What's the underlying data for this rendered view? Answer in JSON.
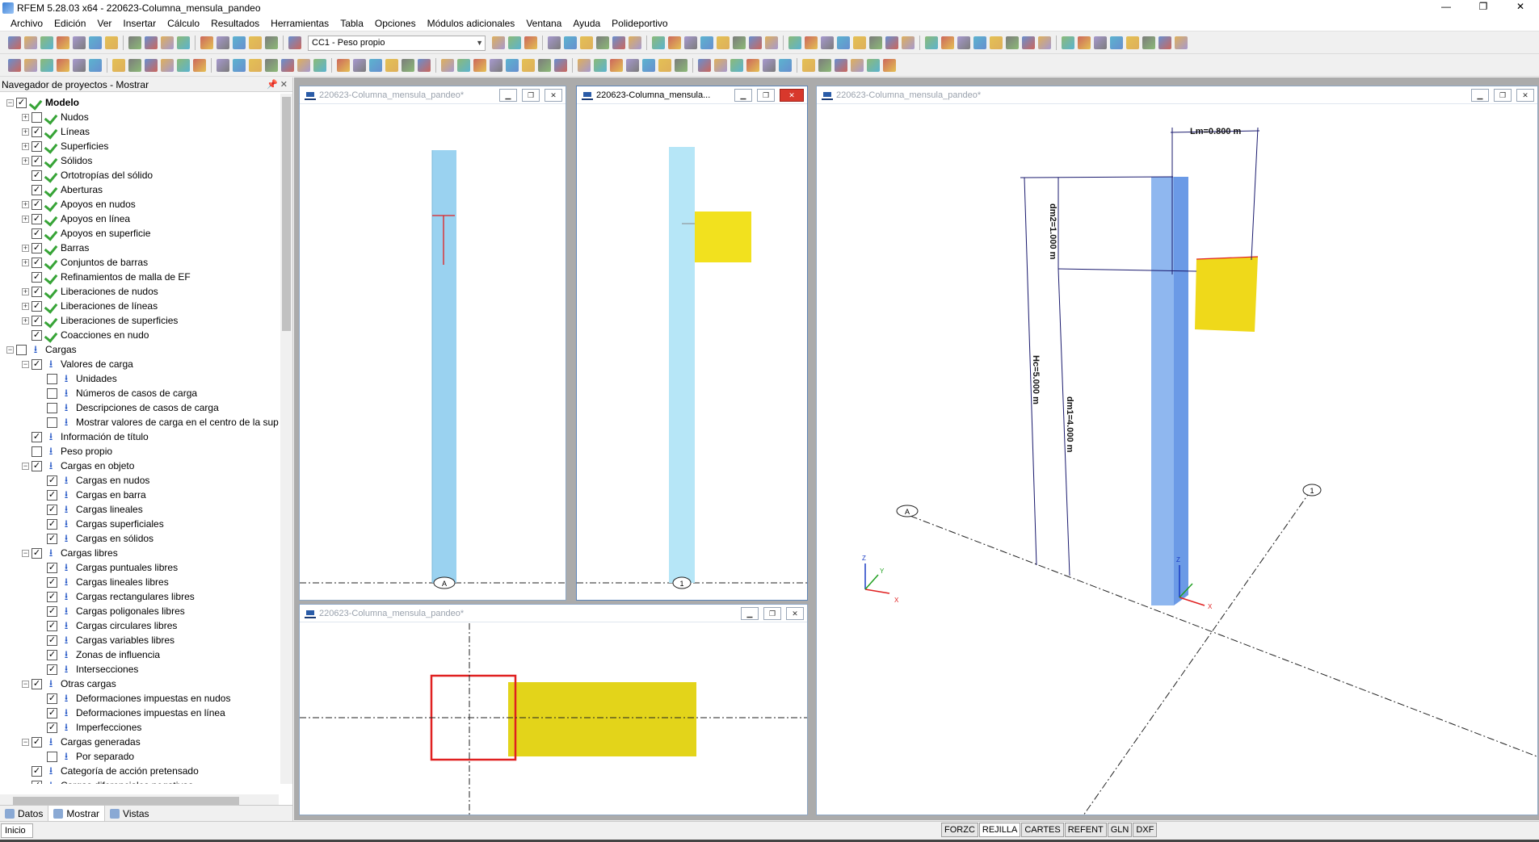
{
  "app": {
    "title": "RFEM 5.28.03 x64 - 220623-Columna_mensula_pandeo",
    "window_buttons": [
      "—",
      "❐",
      "✕"
    ]
  },
  "menu": [
    "Archivo",
    "Edición",
    "Ver",
    "Insertar",
    "Cálculo",
    "Resultados",
    "Herramientas",
    "Tabla",
    "Opciones",
    "Módulos adicionales",
    "Ventana",
    "Ayuda",
    "Polideportivo"
  ],
  "toolbar": {
    "load_case_combo": "CC1 - Peso propio"
  },
  "navigator": {
    "title": "Navegador de proyectos - Mostrar",
    "pin_icons": "📌 ✕",
    "tabs": [
      {
        "label": "Datos",
        "icon": "data-icon"
      },
      {
        "label": "Mostrar",
        "icon": "display-icon"
      },
      {
        "label": "Vistas",
        "icon": "views-icon"
      }
    ],
    "tree": [
      {
        "level": 0,
        "exp": "−",
        "checked": true,
        "icon": "model",
        "label": "Modelo",
        "bold": true
      },
      {
        "level": 1,
        "exp": "+",
        "checked": false,
        "icon": "model",
        "label": "Nudos"
      },
      {
        "level": 1,
        "exp": "+",
        "checked": true,
        "icon": "model",
        "label": "Líneas"
      },
      {
        "level": 1,
        "exp": "+",
        "checked": true,
        "icon": "model",
        "label": "Superficies"
      },
      {
        "level": 1,
        "exp": "+",
        "checked": true,
        "icon": "model",
        "label": "Sólidos"
      },
      {
        "level": 1,
        "exp": "",
        "checked": true,
        "icon": "model",
        "label": "Ortotropías del sólido"
      },
      {
        "level": 1,
        "exp": "",
        "checked": true,
        "icon": "model",
        "label": "Aberturas"
      },
      {
        "level": 1,
        "exp": "+",
        "checked": true,
        "icon": "model",
        "label": "Apoyos en nudos"
      },
      {
        "level": 1,
        "exp": "+",
        "checked": true,
        "icon": "model",
        "label": "Apoyos en línea"
      },
      {
        "level": 1,
        "exp": "",
        "checked": true,
        "icon": "model",
        "label": "Apoyos en superficie"
      },
      {
        "level": 1,
        "exp": "+",
        "checked": true,
        "icon": "model",
        "label": "Barras"
      },
      {
        "level": 1,
        "exp": "+",
        "checked": true,
        "icon": "model",
        "label": "Conjuntos de barras"
      },
      {
        "level": 1,
        "exp": "",
        "checked": true,
        "icon": "model",
        "label": "Refinamientos de malla de EF"
      },
      {
        "level": 1,
        "exp": "+",
        "checked": true,
        "icon": "model",
        "label": "Liberaciones de nudos"
      },
      {
        "level": 1,
        "exp": "+",
        "checked": true,
        "icon": "model",
        "label": "Liberaciones de líneas"
      },
      {
        "level": 1,
        "exp": "+",
        "checked": true,
        "icon": "model",
        "label": "Liberaciones de superficies"
      },
      {
        "level": 1,
        "exp": "",
        "checked": true,
        "icon": "model",
        "label": "Coacciones en nudo"
      },
      {
        "level": 0,
        "exp": "−",
        "checked": false,
        "icon": "load",
        "label": "Cargas"
      },
      {
        "level": 1,
        "exp": "−",
        "checked": true,
        "icon": "load",
        "label": "Valores de carga"
      },
      {
        "level": 2,
        "exp": "",
        "checked": false,
        "icon": "load",
        "label": "Unidades"
      },
      {
        "level": 2,
        "exp": "",
        "checked": false,
        "icon": "load",
        "label": "Números de casos de carga"
      },
      {
        "level": 2,
        "exp": "",
        "checked": false,
        "icon": "load",
        "label": "Descripciones de casos de carga"
      },
      {
        "level": 2,
        "exp": "",
        "checked": false,
        "icon": "load",
        "label": "Mostrar valores de carga en el centro de la sup"
      },
      {
        "level": 1,
        "exp": "",
        "checked": true,
        "icon": "load",
        "label": "Información de título"
      },
      {
        "level": 1,
        "exp": "",
        "checked": false,
        "icon": "load",
        "label": "Peso propio"
      },
      {
        "level": 1,
        "exp": "−",
        "checked": true,
        "icon": "load",
        "label": "Cargas en objeto"
      },
      {
        "level": 2,
        "exp": "",
        "checked": true,
        "icon": "load",
        "label": "Cargas en nudos"
      },
      {
        "level": 2,
        "exp": "",
        "checked": true,
        "icon": "load",
        "label": "Cargas en barra"
      },
      {
        "level": 2,
        "exp": "",
        "checked": true,
        "icon": "load",
        "label": "Cargas lineales"
      },
      {
        "level": 2,
        "exp": "",
        "checked": true,
        "icon": "load",
        "label": "Cargas superficiales"
      },
      {
        "level": 2,
        "exp": "",
        "checked": true,
        "icon": "load",
        "label": "Cargas en sólidos"
      },
      {
        "level": 1,
        "exp": "−",
        "checked": true,
        "icon": "load",
        "label": "Cargas libres"
      },
      {
        "level": 2,
        "exp": "",
        "checked": true,
        "icon": "load",
        "label": "Cargas puntuales libres"
      },
      {
        "level": 2,
        "exp": "",
        "checked": true,
        "icon": "load",
        "label": "Cargas lineales libres"
      },
      {
        "level": 2,
        "exp": "",
        "checked": true,
        "icon": "load",
        "label": "Cargas rectangulares libres"
      },
      {
        "level": 2,
        "exp": "",
        "checked": true,
        "icon": "load",
        "label": "Cargas poligonales libres"
      },
      {
        "level": 2,
        "exp": "",
        "checked": true,
        "icon": "load",
        "label": "Cargas circulares libres"
      },
      {
        "level": 2,
        "exp": "",
        "checked": true,
        "icon": "load",
        "label": "Cargas variables libres"
      },
      {
        "level": 2,
        "exp": "",
        "checked": true,
        "icon": "load",
        "label": "Zonas de influencia"
      },
      {
        "level": 2,
        "exp": "",
        "checked": true,
        "icon": "load",
        "label": "Intersecciones"
      },
      {
        "level": 1,
        "exp": "−",
        "checked": true,
        "icon": "load",
        "label": "Otras cargas"
      },
      {
        "level": 2,
        "exp": "",
        "checked": true,
        "icon": "load",
        "label": "Deformaciones impuestas en nudos"
      },
      {
        "level": 2,
        "exp": "",
        "checked": true,
        "icon": "load",
        "label": "Deformaciones impuestas en línea"
      },
      {
        "level": 2,
        "exp": "",
        "checked": true,
        "icon": "load",
        "label": "Imperfecciones"
      },
      {
        "level": 1,
        "exp": "−",
        "checked": true,
        "icon": "load",
        "label": "Cargas generadas"
      },
      {
        "level": 2,
        "exp": "",
        "checked": false,
        "icon": "load",
        "label": "Por separado"
      },
      {
        "level": 1,
        "exp": "",
        "checked": true,
        "icon": "load",
        "label": "Categoría de acción pretensado"
      },
      {
        "level": 1,
        "exp": "",
        "checked": true,
        "icon": "load",
        "label": "Cargas diferenciales negativas"
      }
    ]
  },
  "windows": {
    "w1": {
      "title": "220623-Columna_mensula_pandeo*",
      "axis_label": "A"
    },
    "w2": {
      "title": "220623-Columna_mensula...",
      "axis_label": "1"
    },
    "w3": {
      "title": "220623-Columna_mensula_pandeo*"
    },
    "w4": {
      "title": "220623-Columna_mensula_pandeo*"
    }
  },
  "view3d": {
    "dim_lm": "Lm=0.800 m",
    "dim_dm2": "dm2=1.000 m",
    "dim_hc": "Hc=5.000 m",
    "dim_dm1": "dm1=4.000 m",
    "axis_a": "A",
    "axis_1": "1",
    "triad_z": "Z",
    "triad_y": "Y",
    "triad_x": "X",
    "origin_z": "Z",
    "origin_x": "X"
  },
  "status": {
    "start": "Inicio",
    "buttons": [
      {
        "label": "FORZC",
        "on": false
      },
      {
        "label": "REJILLA",
        "on": true
      },
      {
        "label": "CARTES",
        "on": false
      },
      {
        "label": "REFENT",
        "on": false
      },
      {
        "label": "GLN",
        "on": false
      },
      {
        "label": "DXF",
        "on": false
      }
    ]
  },
  "colors": {
    "column_3d": "#8fb7ef",
    "column_side": "#6b9ae6",
    "column_elev": "#9ad2f0",
    "column_light": "#b6e6f7",
    "load_yellow": "#f2e11e",
    "load_yellow_dark": "#e3d41a",
    "dim_line": "#1a1a6e",
    "section_red": "#e02020"
  }
}
